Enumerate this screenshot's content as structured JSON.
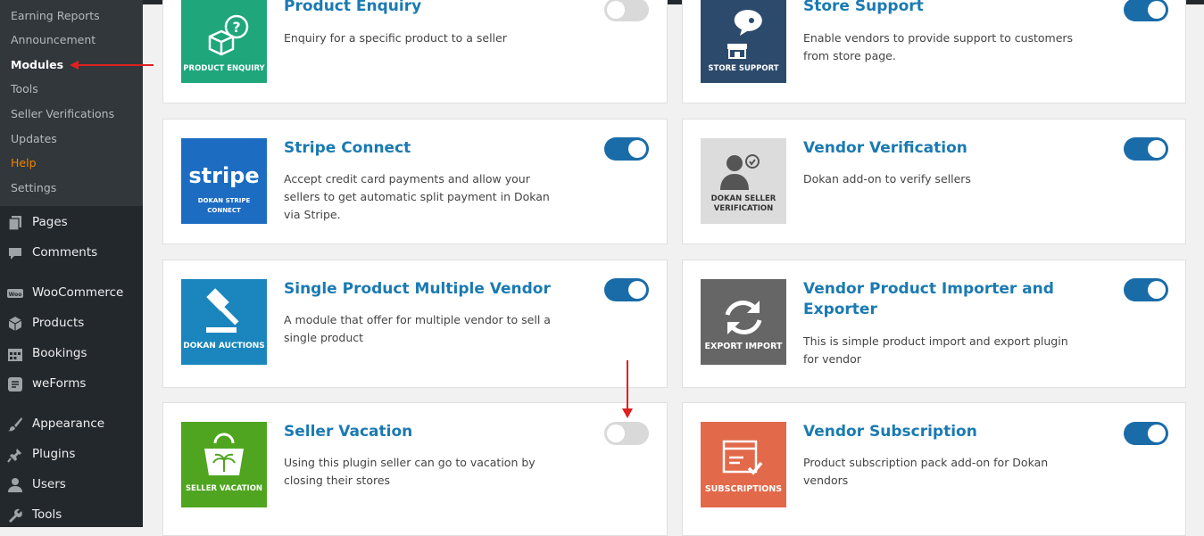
{
  "sidebar": {
    "submenu": [
      {
        "label": "Earning Reports",
        "state": "normal"
      },
      {
        "label": "Announcement",
        "state": "normal"
      },
      {
        "label": "Modules",
        "state": "current"
      },
      {
        "label": "Tools",
        "state": "normal"
      },
      {
        "label": "Seller Verifications",
        "state": "normal"
      },
      {
        "label": "Updates",
        "state": "normal"
      },
      {
        "label": "Help",
        "state": "help"
      },
      {
        "label": "Settings",
        "state": "normal"
      }
    ],
    "menu": [
      {
        "label": "Pages",
        "icon": "pages-icon"
      },
      {
        "label": "Comments",
        "icon": "comments-icon"
      },
      {
        "label": "WooCommerce",
        "icon": "woocommerce-icon"
      },
      {
        "label": "Products",
        "icon": "products-icon"
      },
      {
        "label": "Bookings",
        "icon": "calendar-icon"
      },
      {
        "label": "weForms",
        "icon": "weforms-icon"
      },
      {
        "label": "Appearance",
        "icon": "paintbrush-icon"
      },
      {
        "label": "Plugins",
        "icon": "plugin-icon"
      },
      {
        "label": "Users",
        "icon": "users-icon"
      },
      {
        "label": "Tools",
        "icon": "wrench-icon"
      }
    ]
  },
  "modules": [
    {
      "title": "Product Enquiry",
      "desc_lines": [
        "Enquiry for a specific product to a seller"
      ],
      "enabled": false,
      "thumb_label": [
        "PRODUCT ENQUIRY"
      ],
      "thumb_color": "#1fa67a",
      "thumb_icon": "product-enquiry-icon"
    },
    {
      "title": "Store Support",
      "desc_lines": [
        "Enable vendors to provide support to customers",
        "from store page."
      ],
      "enabled": true,
      "thumb_label": [
        "STORE SUPPORT"
      ],
      "thumb_color": "#2c4a6b",
      "thumb_icon": "store-support-icon"
    },
    {
      "title": "Stripe Connect",
      "desc_lines": [
        "Accept credit card payments and allow your",
        "sellers to get automatic split payment in Dokan",
        "via Stripe."
      ],
      "enabled": true,
      "thumb_label": [
        "DOKAN STRIPE CONNECT"
      ],
      "thumb_wordmark": "stripe",
      "thumb_color": "#1c6cc2",
      "thumb_icon": "stripe-icon"
    },
    {
      "title": "Vendor Verification",
      "desc_lines": [
        "Dokan add-on to verify sellers"
      ],
      "enabled": true,
      "thumb_label": [
        "DOKAN SELLER",
        "VERIFICATION"
      ],
      "thumb_color": "#d9d9d9",
      "thumb_icon": "seller-verification-icon"
    },
    {
      "title": "Single Product Multiple Vendor",
      "desc_lines": [
        "A module that offer for multiple vendor to sell a",
        "single product"
      ],
      "enabled": true,
      "thumb_label": [
        "DOKAN AUCTIONS"
      ],
      "thumb_color": "#1a86bd",
      "thumb_icon": "auction-gavel-icon"
    },
    {
      "title_lines": [
        "Vendor Product Importer and",
        "Exporter"
      ],
      "desc_lines": [
        "This is simple product import and export plugin",
        "for vendor"
      ],
      "enabled": true,
      "thumb_label": [
        "EXPORT IMPORT"
      ],
      "thumb_color": "#666666",
      "thumb_icon": "sync-arrows-icon"
    },
    {
      "title": "Seller Vacation",
      "desc_lines": [
        "Using this plugin seller can go to vacation by",
        "closing their stores"
      ],
      "enabled": false,
      "thumb_label": [
        "SELLER VACATION"
      ],
      "thumb_color": "#4fa51f",
      "thumb_icon": "vacation-bag-icon"
    },
    {
      "title": "Vendor Subscription",
      "desc_lines": [
        "Product subscription pack add-on for Dokan",
        "vendors"
      ],
      "enabled": true,
      "thumb_label": [
        "SUBSCRIPTIONS"
      ],
      "thumb_color": "#e2694a",
      "thumb_icon": "subscription-icon"
    }
  ],
  "colors": {
    "sidebar_bg": "#23282d",
    "submenu_bg": "#32373c",
    "title_blue": "#1a7ab2",
    "toggle_on": "#1a6ca8",
    "toggle_off": "#d9d9d9",
    "annotation_arrow": "#e02020"
  }
}
